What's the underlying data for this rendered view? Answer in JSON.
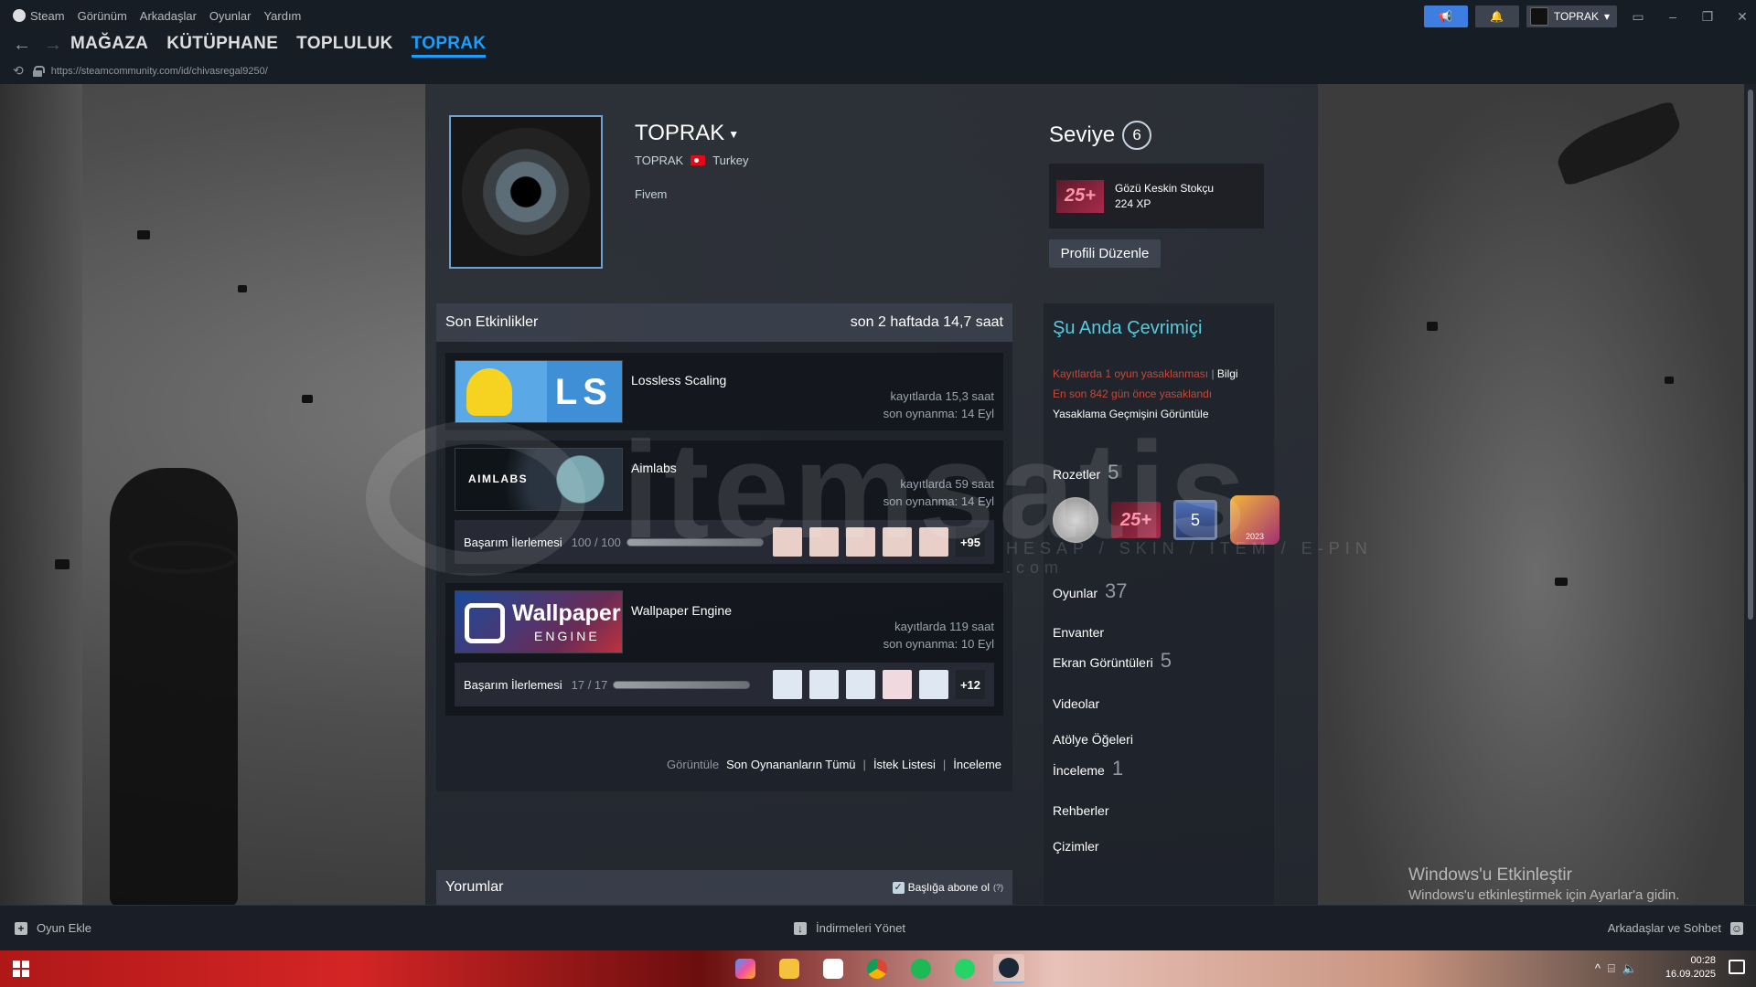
{
  "menu": {
    "items": [
      "Steam",
      "Görünüm",
      "Arkadaşlar",
      "Oyunlar",
      "Yardım"
    ]
  },
  "titlebar": {
    "user_label": "TOPRAK",
    "window_controls": [
      "▭",
      "–",
      "❐",
      "✕"
    ]
  },
  "nav": {
    "back_icon": "←",
    "forward_icon": "→",
    "tabs": [
      "MAĞAZA",
      "KÜTÜPHANE",
      "TOPLULUK",
      "TOPRAK"
    ],
    "active_tab": "TOPRAK",
    "url": "https://steamcommunity.com/id/chivasregal9250/"
  },
  "profile": {
    "name": "TOPRAK",
    "real_name": "TOPRAK",
    "country": "Turkey",
    "summary": "Fivem",
    "level_label": "Seviye",
    "level": "6",
    "favorite_badge": {
      "icon_text": "25+",
      "name": "Gözü Keskin Stokçu",
      "xp": "224 XP"
    },
    "edit_button": "Profili Düzenle"
  },
  "recent": {
    "title": "Son Etkinlikler",
    "hours": "son 2 haftada 14,7 saat",
    "games": [
      {
        "name": "Lossless Scaling",
        "hours": "kayıtlarda 15,3 saat",
        "last": "son oynanma: 14 Eyl",
        "capsule_text": "LS"
      },
      {
        "name": "Aimlabs",
        "hours": "kayıtlarda 59 saat",
        "last": "son oynanma: 14 Eyl",
        "capsule_text": "AIMLABS",
        "achievement_label": "Başarım İlerlemesi",
        "achievement_count": "100 / 100",
        "achievement_progress": 1.0,
        "achievement_more": "+95"
      },
      {
        "name": "Wallpaper Engine",
        "hours": "kayıtlarda 119 saat",
        "last": "son oynanma: 10 Eyl",
        "capsule_text_1": "Wallpaper",
        "capsule_text_2": "ENGINE",
        "achievement_label": "Başarım İlerlemesi",
        "achievement_count": "17 / 17",
        "achievement_progress": 1.0,
        "achievement_more": "+12"
      }
    ],
    "links_label": "Görüntüle",
    "links": [
      "Son Oynananların Tümü",
      "İstek Listesi",
      "İnceleme"
    ]
  },
  "comments": {
    "title": "Yorumlar",
    "subscribe": "Başlığa abone ol",
    "help": "(?)"
  },
  "right": {
    "online": "Şu Anda Çevrimiçi",
    "ban_text": "Kayıtlarda 1 oyun yasaklanması",
    "ban_link": "Bilgi",
    "ban_days": "En son 842 gün önce yasaklandı",
    "ban_history": "Yasaklama Geçmişini Görüntüle",
    "badges_label": "Rozetler",
    "badges_count": "5",
    "badge_25": "25+",
    "badge_5": "5",
    "badge_2023": "2023",
    "games_label": "Oyunlar",
    "games_count": "37",
    "inventory": "Envanter",
    "screenshots_label": "Ekran Görüntüleri",
    "screenshots_count": "5",
    "videos": "Videolar",
    "workshop": "Atölye Öğeleri",
    "reviews_label": "İnceleme",
    "reviews_count": "1",
    "guides": "Rehberler",
    "artwork": "Çizimler"
  },
  "watermark": {
    "main": "itemsatis",
    "sub": "HESAP / SKIN / ITEM / E-PIN",
    "suffix": ".com"
  },
  "windows": {
    "activate_title": "Windows'u Etkinleştir",
    "activate_sub": "Windows'u etkinleştirmek için Ayarlar'a gidin.",
    "time": "00:28",
    "date": "16.09.2025"
  },
  "bottombar": {
    "add_game": "Oyun Ekle",
    "downloads": "İndirmeleri Yönet",
    "friends": "Arkadaşlar ve Sohbet"
  },
  "colors": {
    "accent": "#1a9fff",
    "online": "#57cbde",
    "ban": "#c24a3a"
  }
}
